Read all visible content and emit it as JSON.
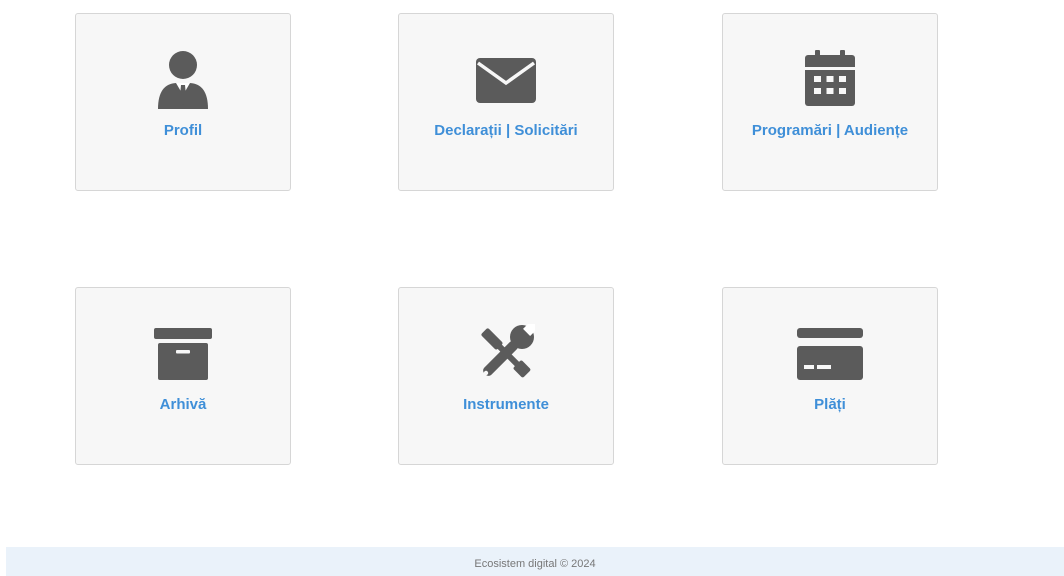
{
  "tiles": [
    {
      "label": "Profil",
      "icon": "user-suit-icon"
    },
    {
      "label": "Declarații | Solicitări",
      "icon": "envelope-icon"
    },
    {
      "label": "Programări | Audiențe",
      "icon": "calendar-icon"
    },
    {
      "label": "Arhivă",
      "icon": "archive-box-icon"
    },
    {
      "label": "Instrumente",
      "icon": "tools-icon"
    },
    {
      "label": "Plăți",
      "icon": "credit-card-icon"
    }
  ],
  "footer": {
    "text": "Ecosistem digital © 2024"
  },
  "colors": {
    "label": "#3f8fd8",
    "icon": "#5b5b5b",
    "tile_bg": "#f7f7f7",
    "footer_bg": "#eaf2fa"
  }
}
